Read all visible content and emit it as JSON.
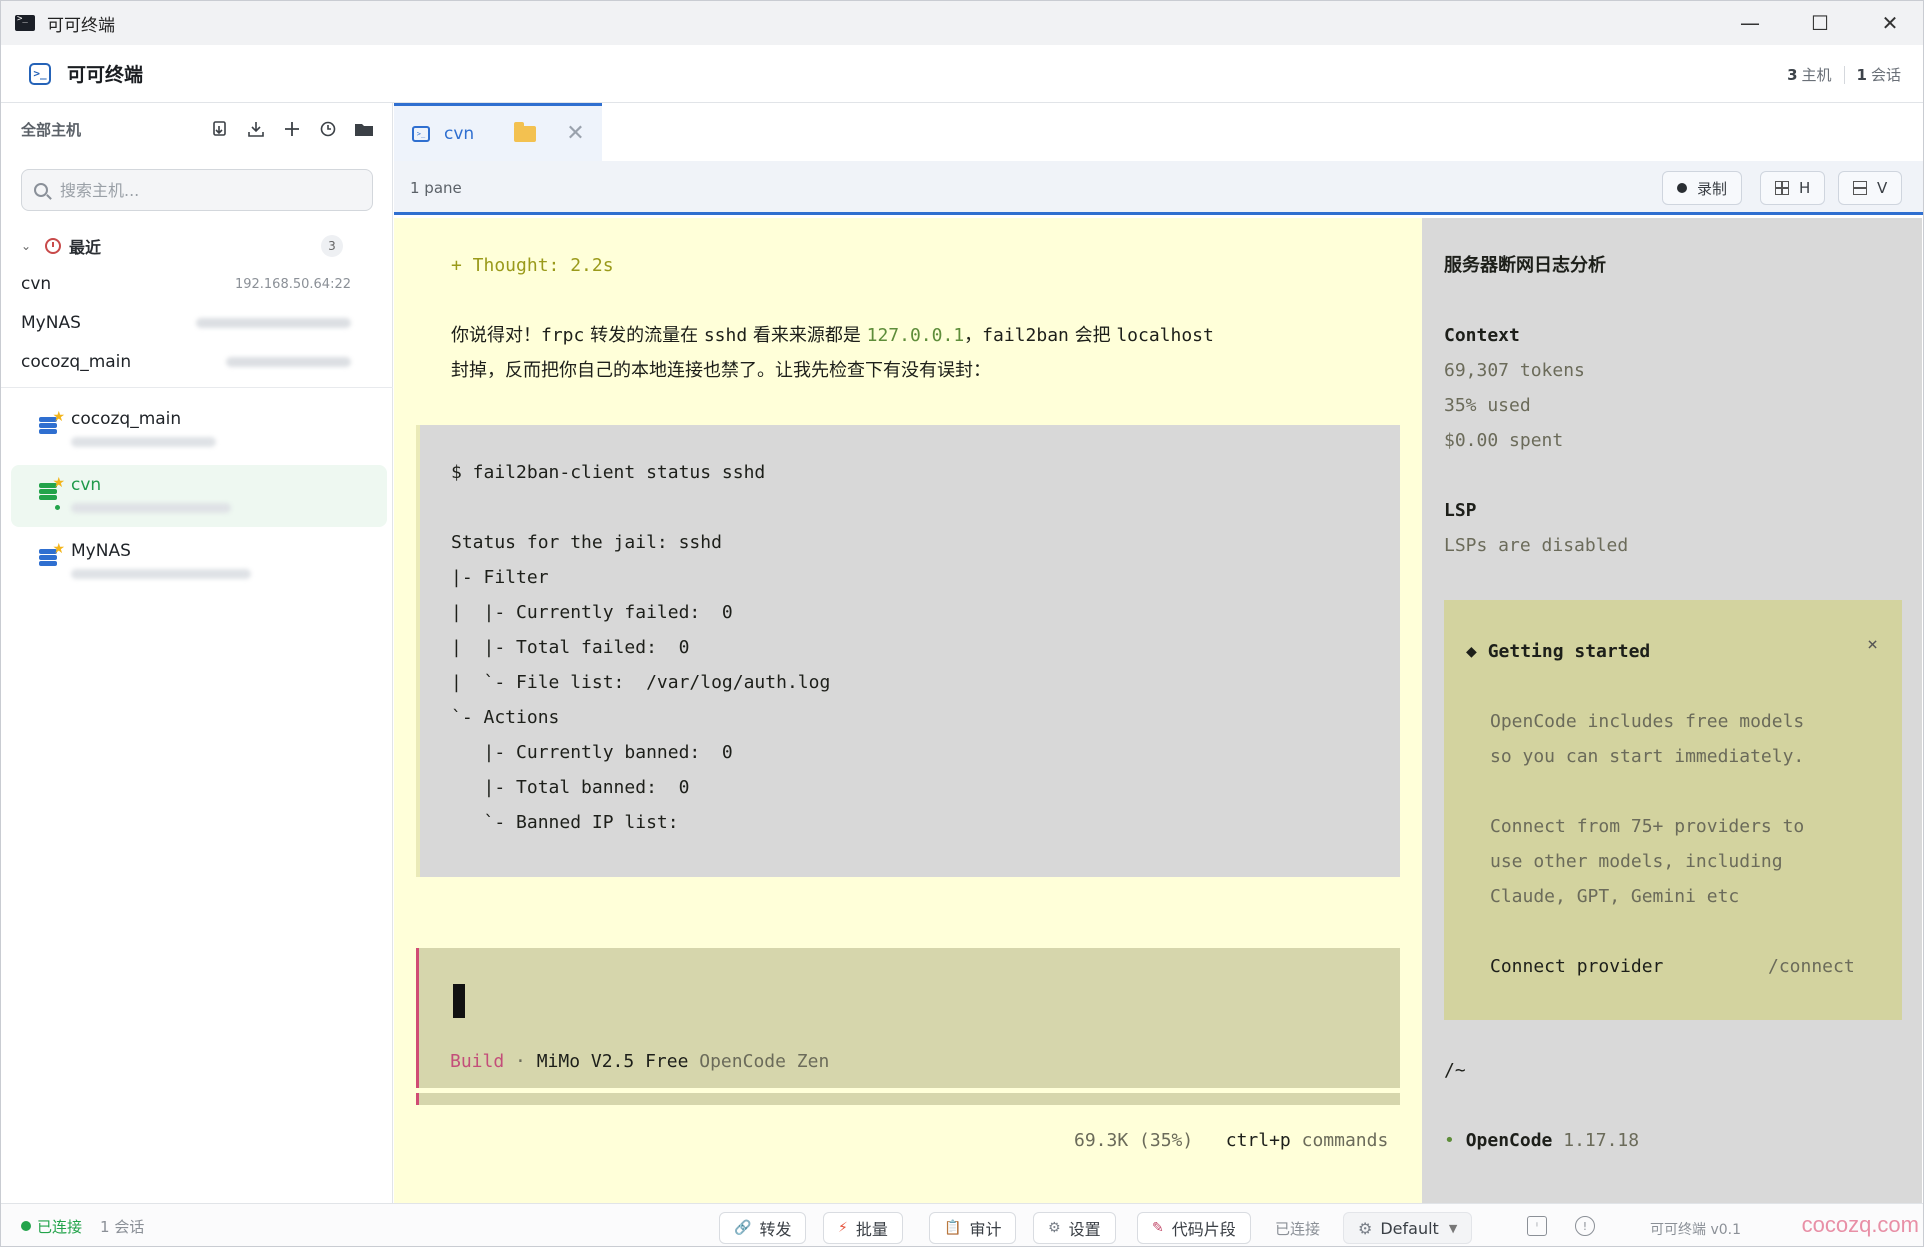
{
  "window": {
    "title": "可可终端",
    "minimize": "—",
    "maximize": "☐",
    "close": "✕"
  },
  "header": {
    "title": "可可终端",
    "hosts_count": "3",
    "hosts_label": "主机",
    "sessions_count": "1",
    "sessions_label": "会话"
  },
  "sidebar": {
    "title": "全部主机",
    "search_placeholder": "搜索主机...",
    "recent": {
      "label": "最近",
      "count": "3",
      "items": [
        {
          "name": "cvn",
          "addr": "192.168.50.64:22"
        },
        {
          "name": "MyNAS",
          "addr": ""
        },
        {
          "name": "cocozq_main",
          "addr": ""
        }
      ]
    },
    "hosts": [
      {
        "name": "cocozq_main"
      },
      {
        "name": "cvn"
      },
      {
        "name": "MyNAS"
      }
    ]
  },
  "tabs": [
    {
      "label": "cvn"
    }
  ],
  "panebar": {
    "pane_count": "1 pane",
    "record": "录制",
    "split_h": "H",
    "split_v": "V"
  },
  "terminal": {
    "thought": "+ Thought: 2.2s",
    "msg1_a": "你说得对！",
    "msg1_b": "frpc",
    "msg1_c": " 转发的流量在 ",
    "msg1_d": "sshd",
    "msg1_e": " 看来来源都是 ",
    "msg1_ip": "127.0.0.1",
    "msg1_f": "，",
    "msg1_g": "fail2ban",
    "msg1_h": " 会把 ",
    "msg1_i": "localhost",
    "msg2": "封掉，反而把你自己的本地连接也禁了。让我先检查下有没有误封：",
    "code": [
      "$ fail2ban-client status sshd",
      "",
      "Status for the jail: sshd",
      "|- Filter",
      "|  |- Currently failed:  0",
      "|  |- Total failed:  0",
      "|  `- File list:  /var/log/auth.log",
      "`- Actions",
      "   |- Currently banned:  0",
      "   |- Total banned:  0",
      "   `- Banned IP list:"
    ],
    "build_mode": "Build",
    "build_sep": " · ",
    "build_model": "MiMo V2.5 Free",
    "build_provider": " OpenCode Zen",
    "ctx_usage": "69.3K (35%)",
    "cmd_key": "ctrl+p",
    "cmd_label": " commands",
    "right": {
      "title": "服务器断网日志分析",
      "context_label": "Context",
      "tokens": "69,307 tokens",
      "used": "35% used",
      "spent": "$0.00 spent",
      "lsp_label": "LSP",
      "lsp_status": "LSPs are disabled",
      "gs_title": "Getting started",
      "gs_close": "×",
      "gs_lines": [
        "OpenCode includes free models",
        "so you can start immediately.",
        "",
        "Connect from 75+ providers to",
        "use other models, including",
        "Claude, GPT, Gemini etc"
      ],
      "connect_label": "Connect provider",
      "connect_cmd": "/connect",
      "path": "/~",
      "app_name": "OpenCode",
      "app_version": " 1.17.18"
    }
  },
  "statusbar": {
    "connected": "已连接",
    "sessions": "1 会话",
    "forward": "转发",
    "batch": "批量",
    "audit": "审计",
    "settings": "设置",
    "snippets": "代码片段",
    "status2": "已连接",
    "theme": "Default",
    "version": "可可终端 v0.1",
    "watermark": "cocozq.com"
  }
}
